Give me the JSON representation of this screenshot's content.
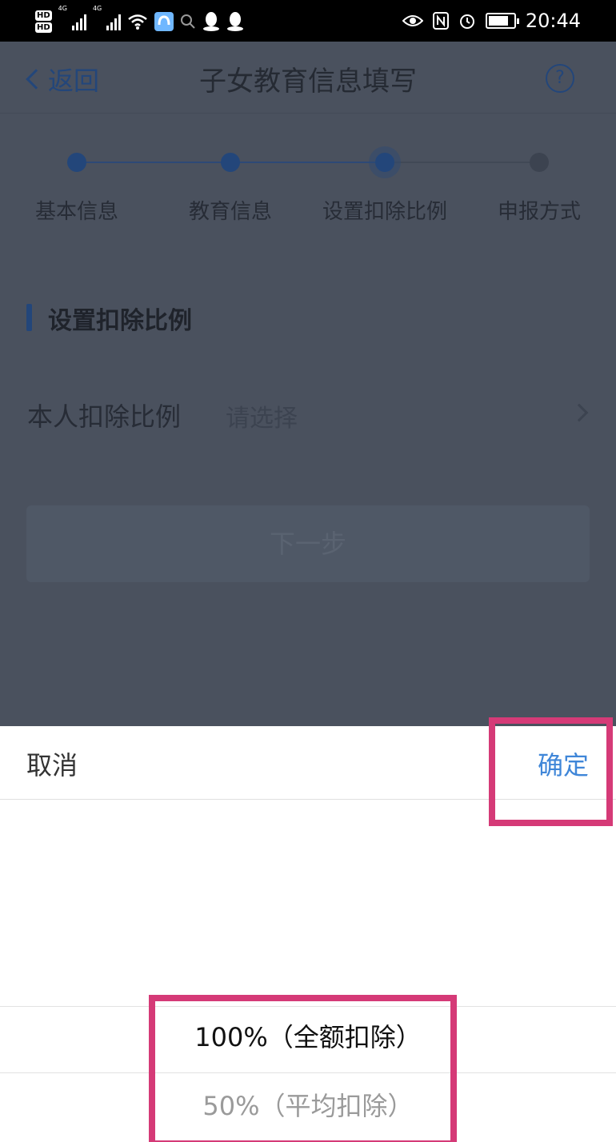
{
  "status_bar": {
    "hd1": "HD",
    "hd2": "HD",
    "net1": "4G",
    "net2": "4G",
    "time": "20:44"
  },
  "nav": {
    "back_label": "返回",
    "title": "子女教育信息填写",
    "help_glyph": "?"
  },
  "steps": [
    {
      "label": "基本信息",
      "state": "done"
    },
    {
      "label": "教育信息",
      "state": "done"
    },
    {
      "label": "设置扣除比例",
      "state": "current"
    },
    {
      "label": "申报方式",
      "state": "pending"
    }
  ],
  "section": {
    "title": "设置扣除比例"
  },
  "form": {
    "label": "本人扣除比例",
    "placeholder": "请选择"
  },
  "next_button": {
    "label": "下一步"
  },
  "sheet": {
    "cancel_label": "取消",
    "confirm_label": "确定",
    "options": [
      {
        "label": "100%（全额扣除）",
        "selected": true
      },
      {
        "label": "50%（平均扣除）",
        "selected": false
      }
    ]
  },
  "colors": {
    "overlay": "#4a515e",
    "accent": "#3f86d8",
    "step_done": "#23467a",
    "step_pending": "#3c4350",
    "highlight": "#d53a77"
  }
}
